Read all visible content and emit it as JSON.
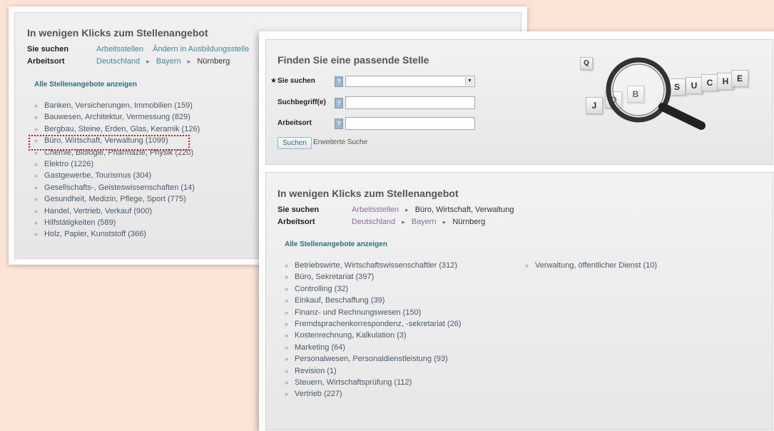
{
  "back": {
    "heading": "In wenigen Klicks zum Stellenangebot",
    "sie_suchen_label": "Sie suchen",
    "sie_suchen_value": "Arbeitsstellen",
    "sie_suchen_change": "Ändern in Ausbildungsstelle",
    "arbeitsort_label": "Arbeitsort",
    "arbeitsort_crumbs": [
      "Deutschland",
      "Bayern",
      "Nürnberg"
    ],
    "all_link": "Alle Stellenangebote anzeigen",
    "categories": [
      "Banken, Versicherungen, Immobilien (159)",
      "Bauwesen, Architektur, Vermessung (829)",
      "Bergbau, Steine, Erden, Glas, Keramik (126)",
      "Büro, Wirtschaft, Verwaltung (1099)",
      "Chemie, Biologie, Pharmazie, Physik (220)",
      "Elektro (1226)",
      "Gastgewerbe, Tourismus (304)",
      "Gesellschafts-, Geisteswissenschaften (14)",
      "Gesundheit, Medizin, Pflege, Sport (775)",
      "Handel, Vertrieb, Verkauf (900)",
      "Hilfstätigkeiten (589)",
      "Holz, Papier, Kunststoff (366)"
    ]
  },
  "search": {
    "heading": "Finden Sie eine passende Stelle",
    "required_mark": "★",
    "fields": [
      {
        "label": "Sie suchen",
        "help": "?"
      },
      {
        "label": "Suchbegriff(e)",
        "help": "?"
      },
      {
        "label": "Arbeitsort",
        "help": "?"
      }
    ],
    "select_arrow": "▼",
    "submit": "Suchen",
    "advanced": "Erweiterte Suche",
    "cubes": [
      "J",
      "O",
      "B",
      "S",
      "U",
      "C",
      "H",
      "E",
      "Q"
    ]
  },
  "front": {
    "heading": "In wenigen Klicks zum Stellenangebot",
    "sie_suchen_label": "Sie suchen",
    "sie_suchen_crumbs": [
      "Arbeitsstellen",
      "Büro, Wirtschaft, Verwaltung"
    ],
    "arbeitsort_label": "Arbeitsort",
    "arbeitsort_crumbs": [
      "Deutschland",
      "Bayern",
      "Nürnberg"
    ],
    "all_link": "Alle Stellenangebote anzeigen",
    "categories_left": [
      "Betriebswirte, Wirtschaftswissenschaftler (312)",
      "Büro, Sekretariat (397)",
      "Controlling (32)",
      "Einkauf, Beschaffung (39)",
      "Finanz- und Rechnungswesen (150)",
      "Fremdsprachenkorrespondenz, -sekretariat (26)",
      "Kostenrechnung, Kalkulation (3)",
      "Marketing (64)",
      "Personalwesen, Personaldienstleistung (93)",
      "Revision (1)",
      "Steuern, Wirtschaftsprüfung (112)",
      "Vertrieb (227)"
    ],
    "categories_right": [
      "Verwaltung, öffentlicher Dienst (10)"
    ]
  },
  "ui": {
    "bullet": "»",
    "crumb_sep": "▸"
  },
  "colors": {
    "background": "#fbe3d6",
    "highlight": "#d21e1e",
    "link": "#2a6f86"
  }
}
